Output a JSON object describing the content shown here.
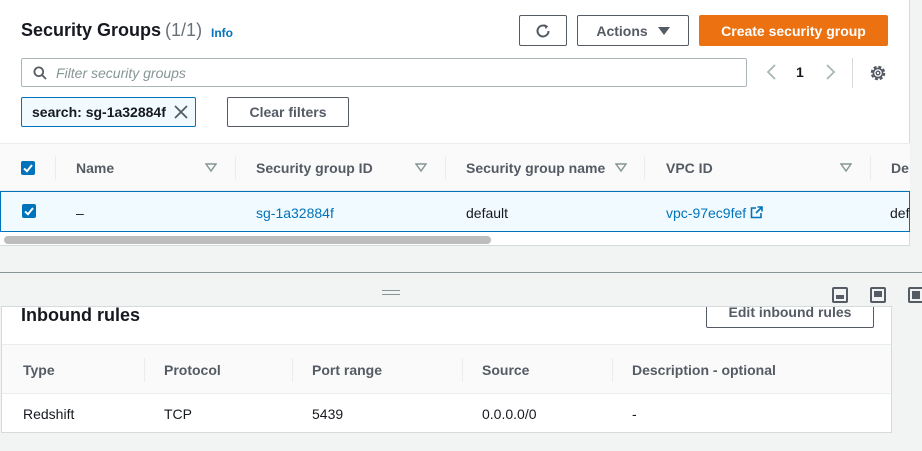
{
  "header": {
    "title": "Security Groups",
    "count": "(1/1)",
    "info_link": "Info",
    "actions_label": "Actions",
    "create_label": "Create security group"
  },
  "search": {
    "placeholder": "Filter security groups",
    "value": ""
  },
  "pagination": {
    "current_page": "1"
  },
  "filter": {
    "token_label": "search: sg-1a32884f",
    "clear_label": "Clear filters"
  },
  "table": {
    "columns": [
      "Name",
      "Security group ID",
      "Security group name",
      "VPC ID",
      "De"
    ],
    "rows": [
      {
        "selected": true,
        "name": "–",
        "security_group_id": "sg-1a32884f",
        "security_group_name": "default",
        "vpc_id": "vpc-97ec9fef",
        "description": "def"
      }
    ]
  },
  "inbound": {
    "title": "Inbound rules",
    "edit_label": "Edit inbound rules",
    "columns": [
      "Type",
      "Protocol",
      "Port range",
      "Source",
      "Description - optional"
    ],
    "rows": [
      {
        "type": "Redshift",
        "protocol": "TCP",
        "port_range": "5439",
        "source": "0.0.0.0/0",
        "description": "-"
      }
    ]
  },
  "colors": {
    "primary": "#ec7211",
    "link": "#0073bb",
    "selected_row_bg": "#f1faff",
    "text": "#16191f",
    "muted": "#545b64"
  },
  "icons": [
    "refresh-icon",
    "caret-down-icon",
    "search-icon",
    "chevron-left-icon",
    "chevron-right-icon",
    "gear-icon",
    "close-icon",
    "sort-down-icon",
    "external-link-icon",
    "drag-handle-icon",
    "layout-bottom-icon",
    "layout-side-icon",
    "layout-split-icon"
  ]
}
